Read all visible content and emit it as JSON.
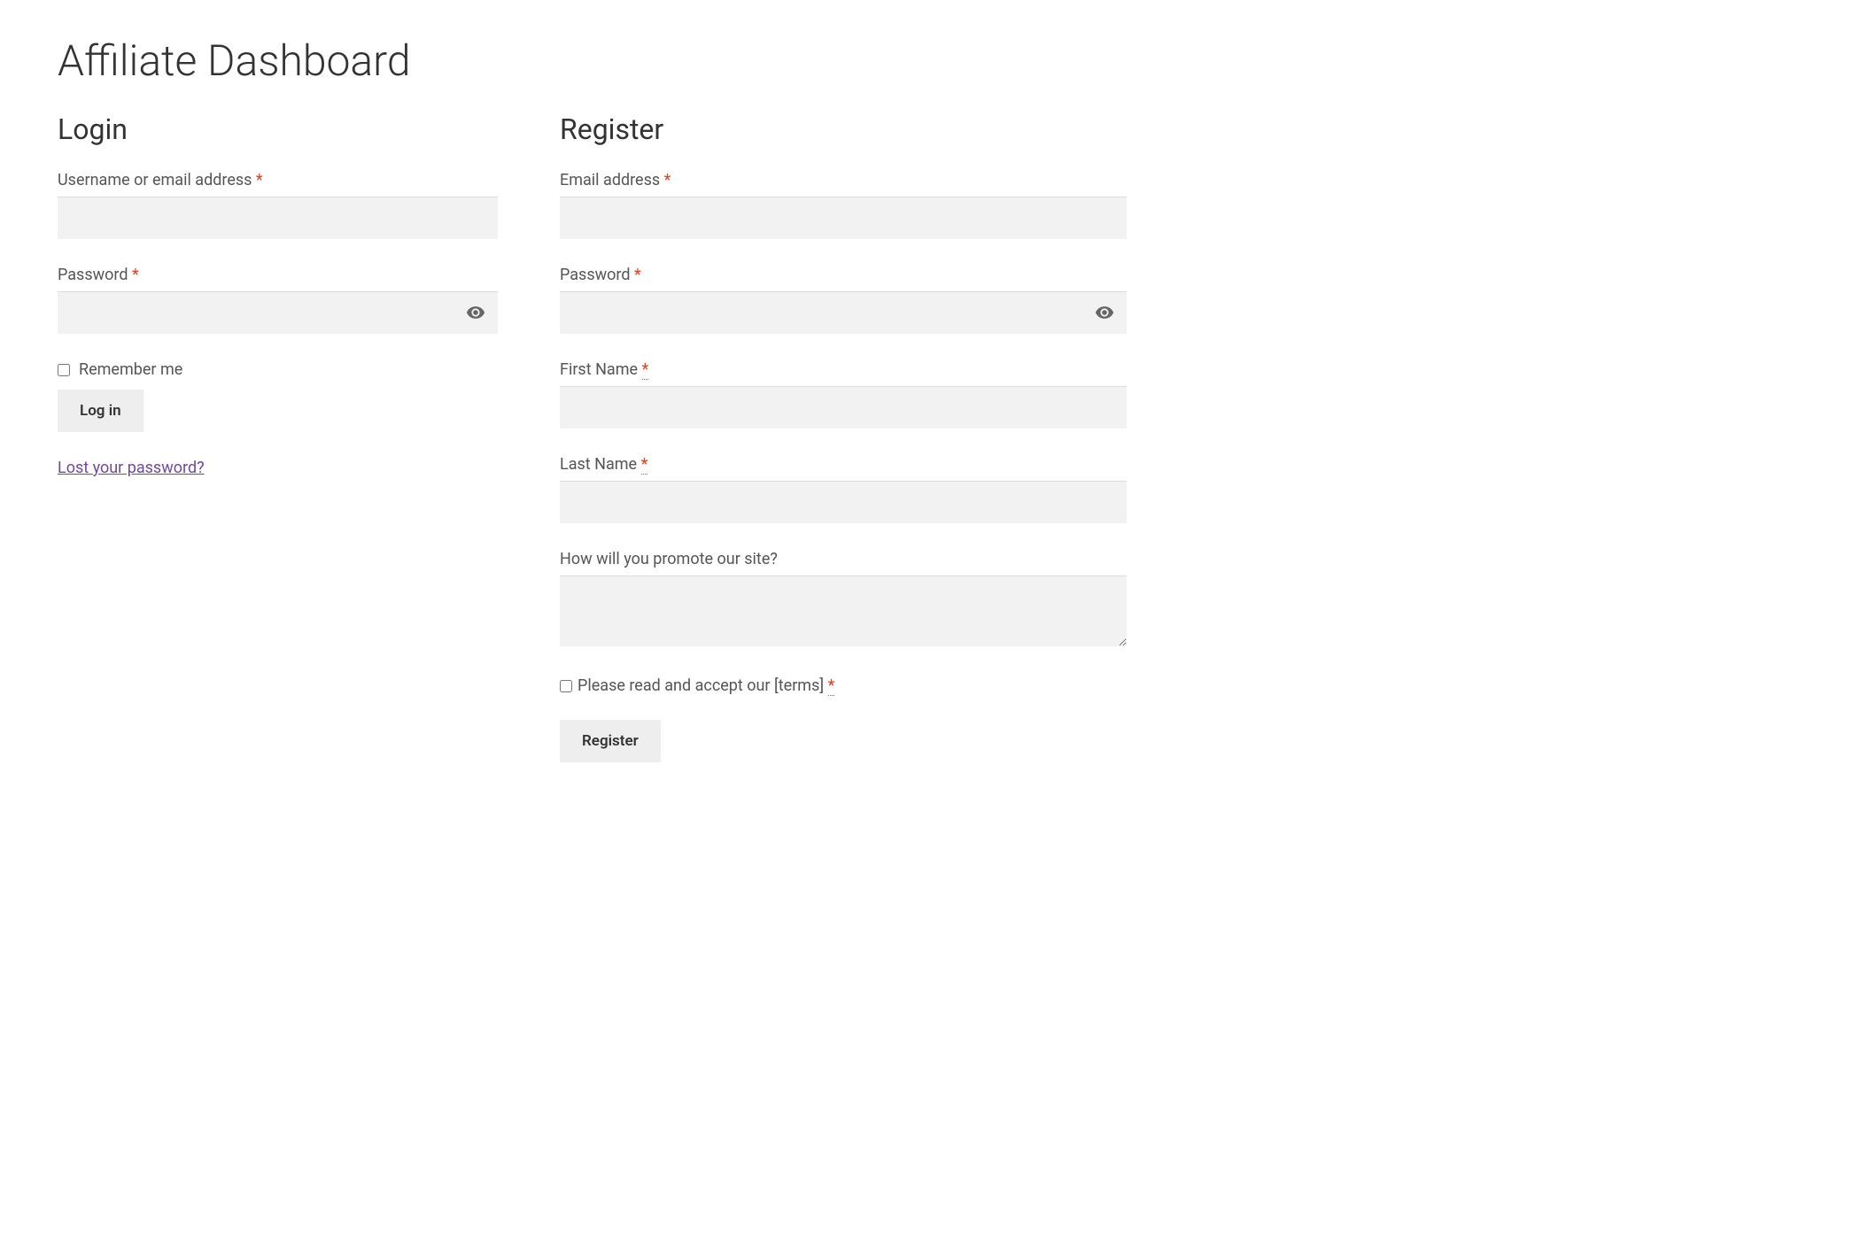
{
  "page": {
    "title": "Affiliate Dashboard"
  },
  "login": {
    "heading": "Login",
    "username_label": "Username or email address ",
    "password_label": "Password ",
    "remember_label": "Remember me",
    "submit_label": "Log in",
    "lost_password_text": "Lost your password?"
  },
  "register": {
    "heading": "Register",
    "email_label": "Email address ",
    "password_label": "Password ",
    "first_name_label": "First Name ",
    "last_name_label": "Last Name ",
    "promote_label": "How will you promote our site?",
    "terms_label": "Please read and accept our [terms] ",
    "submit_label": "Register"
  },
  "required_mark": "*"
}
